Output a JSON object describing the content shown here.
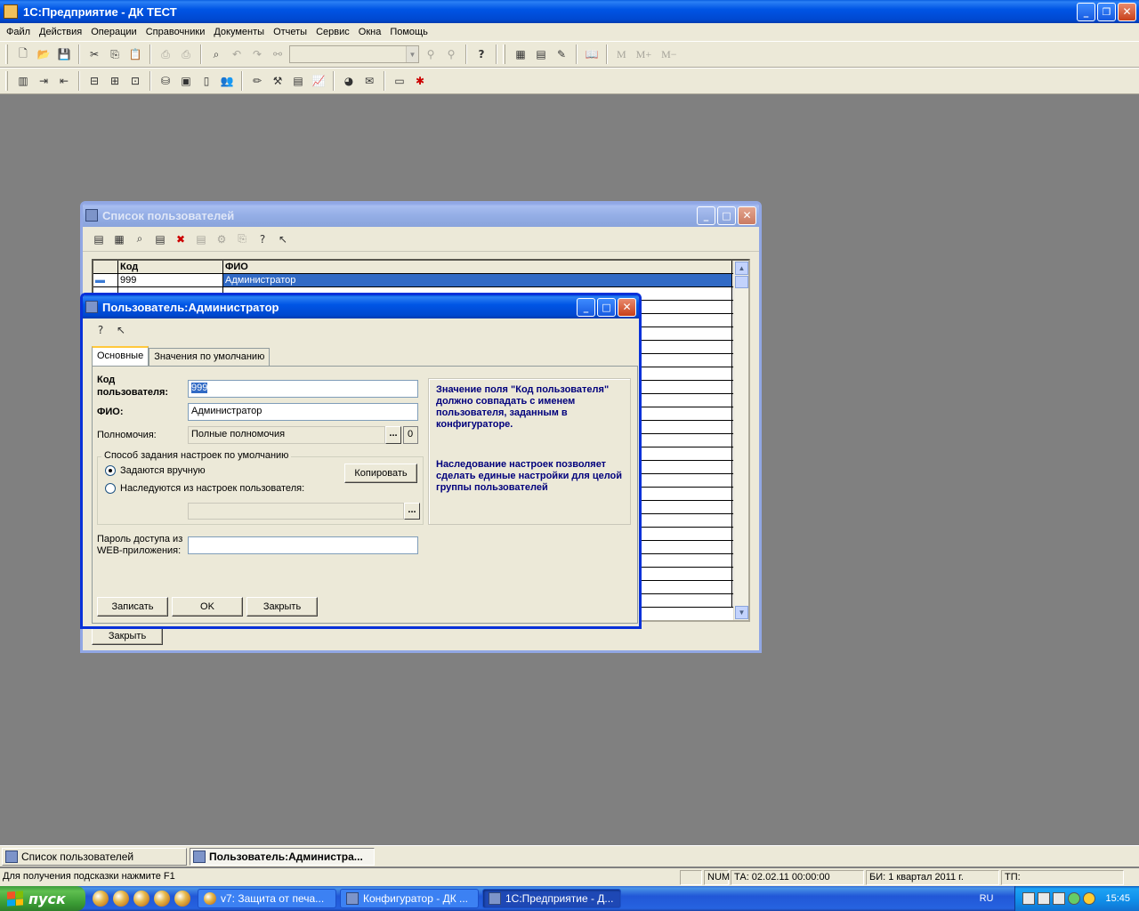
{
  "app": {
    "title": "1С:Предприятие - ДК ТЕСТ",
    "menu": [
      "Файл",
      "Действия",
      "Операции",
      "Справочники",
      "Документы",
      "Отчеты",
      "Сервис",
      "Окна",
      "Помощь"
    ],
    "toolbar_text": {
      "m": "M",
      "m_plus": "M+",
      "m_minus": "M−"
    },
    "toolbar1_icons": [
      "new-document-icon",
      "open-folder-icon",
      "save-icon",
      "cut-icon",
      "copy-icon",
      "paste-icon",
      "print-icon",
      "print-preview-icon",
      "find-icon",
      "undo-icon",
      "redo-icon",
      "binoculars-icon",
      "search-combo",
      "find-next-icon",
      "find-prev-icon",
      "help-icon",
      "calculator-icon",
      "calendar-icon",
      "edit-icon",
      "book-icon"
    ],
    "toolbar2_icons": [
      "journal-icon",
      "enter-icon",
      "exit-icon",
      "chart-of-accounts-icon",
      "analytics-icon",
      "subconto-icon",
      "money-bag-icon",
      "cashbox-icon",
      "document-icon",
      "users-icon",
      "pencil-icon",
      "tools-icon",
      "report-icon",
      "graph-icon",
      "globe-icon",
      "letter-icon",
      "monitor-icon",
      "bug-icon"
    ]
  },
  "list_window": {
    "title": "Список пользователей",
    "columns": {
      "kod": "Код",
      "fio": "ФИО"
    },
    "rows": [
      {
        "kod": "999",
        "fio": "Администратор"
      }
    ],
    "close_button": "Закрыть"
  },
  "user_dialog": {
    "title": "Пользователь:Администратор",
    "tabs": [
      "Основные",
      "Значения по умолчанию"
    ],
    "active_tab": "Основные",
    "code_label_1": "Код",
    "code_label_2": "пользователя:",
    "code_value": "999",
    "fio_label": "ФИО:",
    "fio_value": "Администратор",
    "rights_label": "Полномочия:",
    "rights_value": "Полные полномочия",
    "rights_clear": "0",
    "ellipsis": "...",
    "group_title": "Способ задания настроек по умолчанию",
    "radio_manual": "Задаются вручную",
    "radio_inherit": "Наследуются из настроек пользователя:",
    "copy_button": "Копировать",
    "web_label_1": "Пароль доступа из",
    "web_label_2": "WEB-приложения:",
    "hint_1": "Значение поля \"Код пользователя\" должно совпадать с именем пользователя, заданным в конфигураторе.",
    "hint_2": "Наследование настроек позволяет сделать единые настройки для целой группы пользователей",
    "buttons": {
      "save": "Записать",
      "ok": "OK",
      "close": "Закрыть"
    }
  },
  "window_bar": [
    {
      "label": "Список пользователей",
      "active": false
    },
    {
      "label": "Пользователь:Администра...",
      "active": true
    }
  ],
  "status": {
    "hint": "Для получения подсказки нажмите F1",
    "num": "NUM",
    "ta": "ТА: 02.02.11  00:00:00",
    "bi": "БИ: 1 квартал 2011 г.",
    "tp": "ТП:"
  },
  "taskbar": {
    "start": "пуск",
    "tasks": [
      "v7: Защита от печа...",
      "Конфигуратор - ДК ...",
      "1С:Предприятие - Д..."
    ],
    "active_task": 2,
    "lang": "RU",
    "clock": "15:45"
  }
}
